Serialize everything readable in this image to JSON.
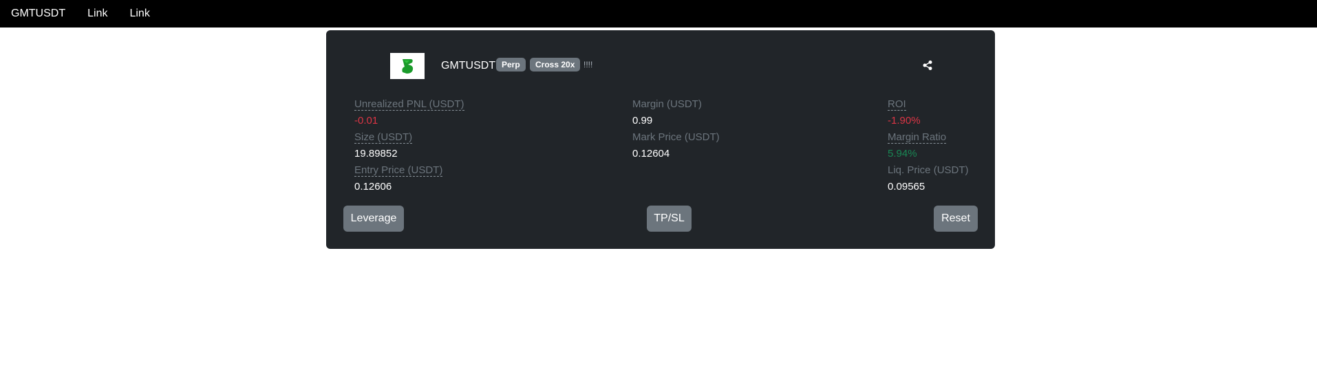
{
  "navbar": {
    "brand": "GMTUSDT",
    "links": [
      "Link",
      "Link"
    ]
  },
  "position": {
    "symbol": "GMTUSDT",
    "badges": [
      "Perp",
      "Cross 20x"
    ],
    "marks": "!!!!",
    "logo_icon": "gmt-logo-icon",
    "share_icon": "share-icon"
  },
  "stats": {
    "unrealized_pnl": {
      "label": "Unrealized PNL (USDT)",
      "value": "-0.01"
    },
    "size": {
      "label": "Size (USDT)",
      "value": "19.89852"
    },
    "entry_price": {
      "label": "Entry Price (USDT)",
      "value": "0.12606"
    },
    "margin": {
      "label": "Margin (USDT)",
      "value": "0.99"
    },
    "mark_price": {
      "label": "Mark Price (USDT)",
      "value": "0.12604"
    },
    "roi": {
      "label": "ROI",
      "value": "-1.90%"
    },
    "margin_ratio": {
      "label": "Margin Ratio",
      "value": "5.94%"
    },
    "liq_price": {
      "label": "Liq. Price (USDT)",
      "value": "0.09565"
    }
  },
  "buttons": {
    "leverage": "Leverage",
    "tpsl": "TP/SL",
    "reset": "Reset"
  },
  "colors": {
    "negative": "#dc3545",
    "positive": "#198754",
    "card_bg": "#212529",
    "badge_bg": "#6c757d"
  }
}
